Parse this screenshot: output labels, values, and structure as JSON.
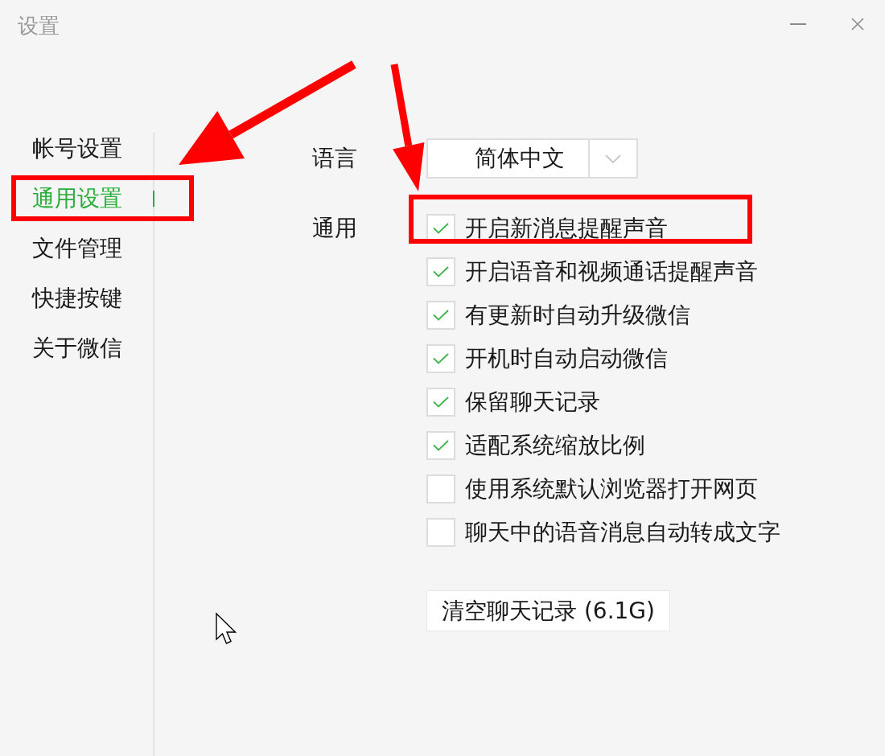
{
  "window": {
    "title": "设置"
  },
  "sidebar": {
    "items": [
      {
        "label": "帐号设置",
        "selected": false,
        "highlighted": false
      },
      {
        "label": "通用设置",
        "selected": true,
        "highlighted": true
      },
      {
        "label": "文件管理",
        "selected": false,
        "highlighted": false
      },
      {
        "label": "快捷按键",
        "selected": false,
        "highlighted": false
      },
      {
        "label": "关于微信",
        "selected": false,
        "highlighted": false
      }
    ]
  },
  "settings": {
    "language": {
      "label": "语言",
      "value": "简体中文"
    },
    "general": {
      "label": "通用",
      "options": [
        {
          "label": "开启新消息提醒声音",
          "checked": true,
          "highlighted": true
        },
        {
          "label": "开启语音和视频通话提醒声音",
          "checked": true,
          "highlighted": false
        },
        {
          "label": "有更新时自动升级微信",
          "checked": true,
          "highlighted": false
        },
        {
          "label": "开机时自动启动微信",
          "checked": true,
          "highlighted": false
        },
        {
          "label": "保留聊天记录",
          "checked": true,
          "highlighted": false
        },
        {
          "label": "适配系统缩放比例",
          "checked": true,
          "highlighted": false
        },
        {
          "label": "使用系统默认浏览器打开网页",
          "checked": false,
          "highlighted": false
        },
        {
          "label": "聊天中的语音消息自动转成文字",
          "checked": false,
          "highlighted": false
        }
      ]
    },
    "clear_button": {
      "label": "清空聊天记录 (6.1G)"
    }
  },
  "annotations": [
    {
      "kind": "arrow"
    },
    {
      "kind": "arrow"
    }
  ]
}
